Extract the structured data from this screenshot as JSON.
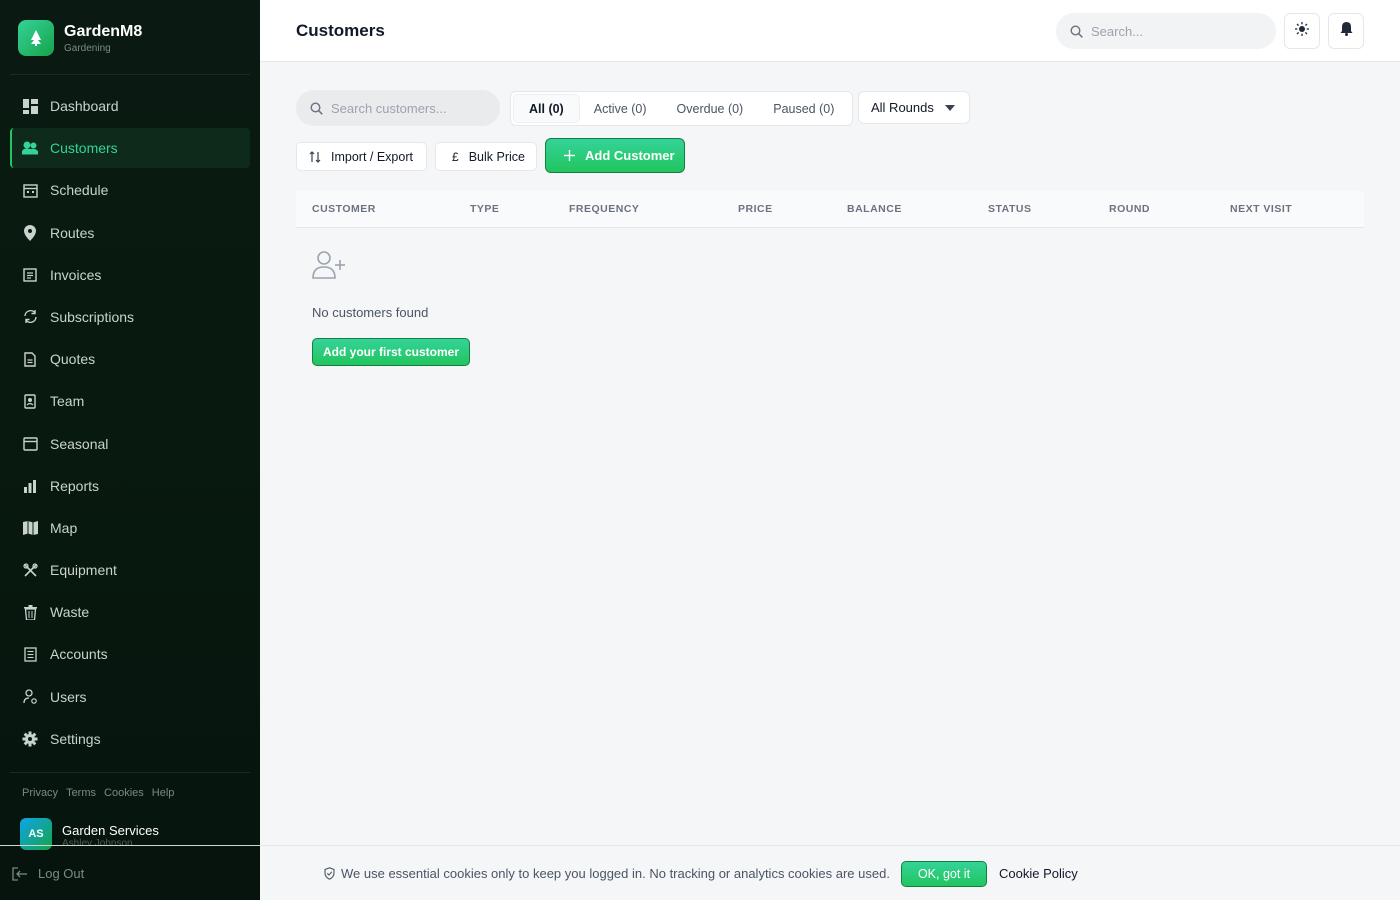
{
  "app": {
    "name": "GardenM8",
    "subtitle": "Gardening"
  },
  "sidebar": {
    "items": [
      {
        "label": "Dashboard",
        "icon": "dashboard-icon"
      },
      {
        "label": "Customers",
        "icon": "users-icon",
        "active": true
      },
      {
        "label": "Schedule",
        "icon": "calendar-icon"
      },
      {
        "label": "Routes",
        "icon": "map-pin-icon"
      },
      {
        "label": "Invoices",
        "icon": "invoice-icon"
      },
      {
        "label": "Subscriptions",
        "icon": "refresh-icon"
      },
      {
        "label": "Quotes",
        "icon": "document-icon"
      },
      {
        "label": "Team",
        "icon": "badge-icon"
      },
      {
        "label": "Seasonal",
        "icon": "calendar-box-icon"
      },
      {
        "label": "Reports",
        "icon": "bar-chart-icon"
      },
      {
        "label": "Map",
        "icon": "map-icon"
      },
      {
        "label": "Equipment",
        "icon": "tools-icon"
      },
      {
        "label": "Waste",
        "icon": "trash-icon"
      },
      {
        "label": "Accounts",
        "icon": "ledger-icon"
      },
      {
        "label": "Users",
        "icon": "user-cog-icon"
      },
      {
        "label": "Settings",
        "icon": "gear-icon"
      }
    ],
    "footer_links": [
      "Privacy",
      "Terms",
      "Cookies",
      "Help"
    ],
    "user": {
      "initials": "AS",
      "company": "Garden Services",
      "name": "Ashley Johnson"
    },
    "logout_label": "Log Out"
  },
  "header": {
    "title": "Customers",
    "search_placeholder": "Search..."
  },
  "toolbar": {
    "search_placeholder": "Search customers...",
    "tabs": [
      "All (0)",
      "Active (0)",
      "Overdue (0)",
      "Paused (0)"
    ],
    "round_filter": "All Rounds",
    "import_export_label": "Import / Export",
    "bulk_price_label": "Bulk Price",
    "bulk_price_symbol": "£",
    "add_customer_label": "Add Customer"
  },
  "table": {
    "columns": [
      "CUSTOMER",
      "TYPE",
      "FREQUENCY",
      "PRICE",
      "BALANCE",
      "STATUS",
      "ROUND",
      "NEXT VISIT"
    ]
  },
  "empty_state": {
    "message": "No customers found",
    "button_label": "Add your first customer"
  },
  "cookie_bar": {
    "message": "We use essential cookies only to keep you logged in. No tracking or analytics cookies are used.",
    "ok_label": "OK, got it",
    "policy_label": "Cookie Policy"
  },
  "colors": {
    "accent": "#22c55e",
    "sidebar_bg": "#0a1a12",
    "active_text": "#34d399"
  }
}
